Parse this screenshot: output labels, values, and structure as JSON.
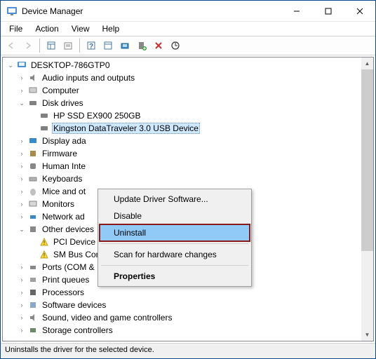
{
  "title": "Device Manager",
  "menu": {
    "file": "File",
    "action": "Action",
    "view": "View",
    "help": "Help"
  },
  "root": "DESKTOP-786GTP0",
  "nodes": {
    "audio": "Audio inputs and outputs",
    "computer": "Computer",
    "disk": "Disk drives",
    "disk_hp": "HP SSD EX900 250GB",
    "disk_kingston": "Kingston DataTraveler 3.0 USB Device",
    "display": "Display ada",
    "firmware": "Firmware",
    "hid": "Human Inte",
    "keyboards": "Keyboards",
    "mice": "Mice and ot",
    "monitors": "Monitors",
    "network": "Network ad",
    "other": "Other devices",
    "pci": "PCI Device",
    "smbus": "SM Bus Controller",
    "ports": "Ports (COM & LPT)",
    "printq": "Print queues",
    "proc": "Processors",
    "soft": "Software devices",
    "sound": "Sound, video and game controllers",
    "storage": "Storage controllers"
  },
  "context": {
    "update": "Update Driver Software...",
    "disable": "Disable",
    "uninstall": "Uninstall",
    "scan": "Scan for hardware changes",
    "properties": "Properties"
  },
  "status": "Uninstalls the driver for the selected device."
}
